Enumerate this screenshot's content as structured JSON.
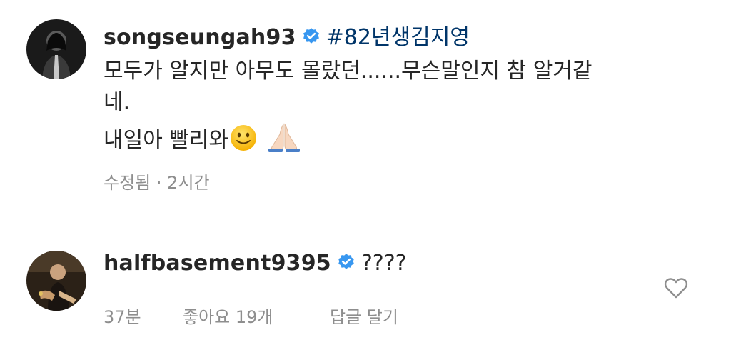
{
  "post": {
    "username": "songseungah93",
    "hashtag": "#82년생김지영",
    "caption_line1": "모두가 알지만 아무도 몰랐던......무슨말인지 참 알거같",
    "caption_line2": "네.",
    "caption_line3": "내일아 빨리와",
    "emojis": [
      "slightly-smiling-face",
      "folded-hands"
    ],
    "edited_label": "수정됨",
    "separator": "·",
    "time": "2시간"
  },
  "reply": {
    "username": "halfbasement9395",
    "text": "????",
    "time": "37분",
    "likes": "좋아요 19개",
    "reply_label": "답글 달기"
  },
  "colors": {
    "text": "#262626",
    "hashtag": "#003569",
    "meta": "#8e8e8e",
    "verified": "#3897f0",
    "divider": "#dbdbdb"
  }
}
